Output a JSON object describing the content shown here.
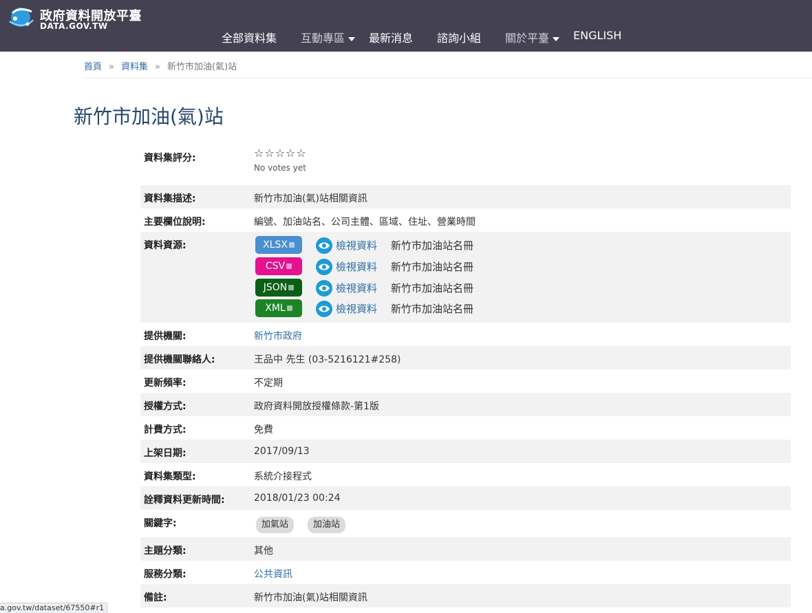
{
  "header": {
    "site_title": "政府資料開放平臺",
    "site_sub": "DATA.GOV.TW",
    "nav": [
      "全部資料集",
      "互動專區",
      "最新消息",
      "諮詢小組",
      "關於平臺",
      "ENGLISH"
    ]
  },
  "breadcrumb": {
    "home": "首頁",
    "section": "資料集",
    "current": "新竹市加油(氣)站",
    "separator": "»"
  },
  "page_title": "新竹市加油(氣)站",
  "rating": {
    "label": "資料集評分:",
    "stars": "☆☆☆☆☆",
    "votes_text": "No votes yet",
    "value": 0,
    "max": 5
  },
  "details": {
    "description": {
      "label": "資料集描述:",
      "value": "新竹市加油(氣)站相關資訊"
    },
    "fields": {
      "label": "主要欄位說明:",
      "value": "編號、加油站名、公司主體、區域、住址、營業時間"
    },
    "resources_label": "資料資源:",
    "resources": [
      {
        "format": "XLSX",
        "color": "#4a8fd0",
        "view": "檢視資料",
        "name": "新竹市加油站名冊"
      },
      {
        "format": "CSV",
        "color": "#e5118f",
        "view": "檢視資料",
        "name": "新竹市加油站名冊"
      },
      {
        "format": "JSON",
        "color": "#0b5e16",
        "view": "檢視資料",
        "name": "新竹市加油站名冊"
      },
      {
        "format": "XML",
        "color": "#1c8427",
        "view": "檢視資料",
        "name": "新竹市加油站名冊"
      }
    ],
    "provider": {
      "label": "提供機關:",
      "value": "新竹市政府"
    },
    "contact": {
      "label": "提供機關聯絡人:",
      "value": "王品中 先生 (03-5216121#258)"
    },
    "frequency": {
      "label": "更新頻率:",
      "value": "不定期"
    },
    "license": {
      "label": "授權方式:",
      "value": "政府資料開放授權條款-第1版"
    },
    "fee": {
      "label": "計費方式:",
      "value": "免費"
    },
    "published": {
      "label": "上架日期:",
      "value": "2017/09/13"
    },
    "type": {
      "label": "資料集類型:",
      "value": "系統介接程式"
    },
    "metadata_updated": {
      "label": "詮釋資料更新時間:",
      "value": "2018/01/23 00:24"
    },
    "keywords_label": "關鍵字:",
    "keywords": [
      "加氣站",
      "加油站"
    ],
    "category": {
      "label": "主題分類:",
      "value": "其他"
    },
    "service": {
      "label": "服務分類:",
      "value": "公共資訊"
    },
    "remarks": {
      "label": "備註:",
      "value": "新竹市加油(氣)站相關資訊"
    }
  },
  "status_url": "a.gov.tw/dataset/67550#r1"
}
